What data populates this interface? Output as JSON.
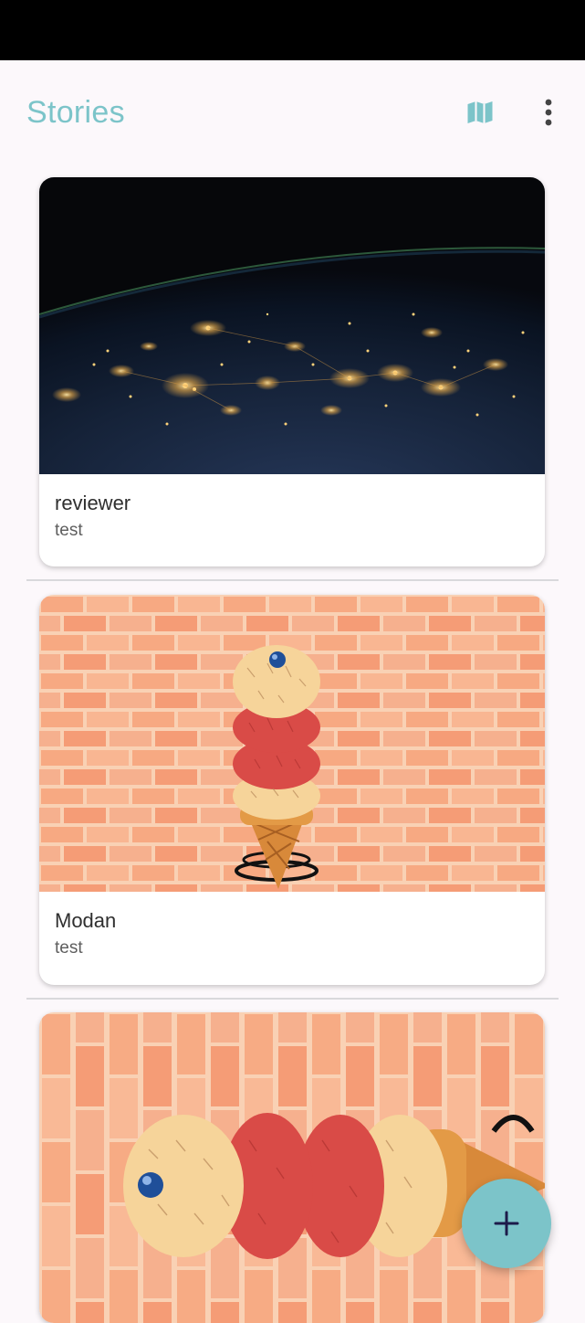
{
  "app_bar": {
    "title": "Stories",
    "icons": [
      "map-icon",
      "more-vert-icon"
    ]
  },
  "stories": [
    {
      "name": "reviewer",
      "description": "test",
      "image": "earth-night-lights-photo"
    },
    {
      "name": "Modan",
      "description": "test",
      "image": "ice-cream-cone-brick-wall"
    },
    {
      "name": "",
      "description": "",
      "image": "ice-cream-cone-sideways-brick-wall"
    }
  ],
  "fab": {
    "icon": "plus-icon"
  },
  "colors": {
    "accent": "#7cc4c9",
    "background": "#fcf8fb",
    "fab_icon": "#1d1b4a"
  }
}
